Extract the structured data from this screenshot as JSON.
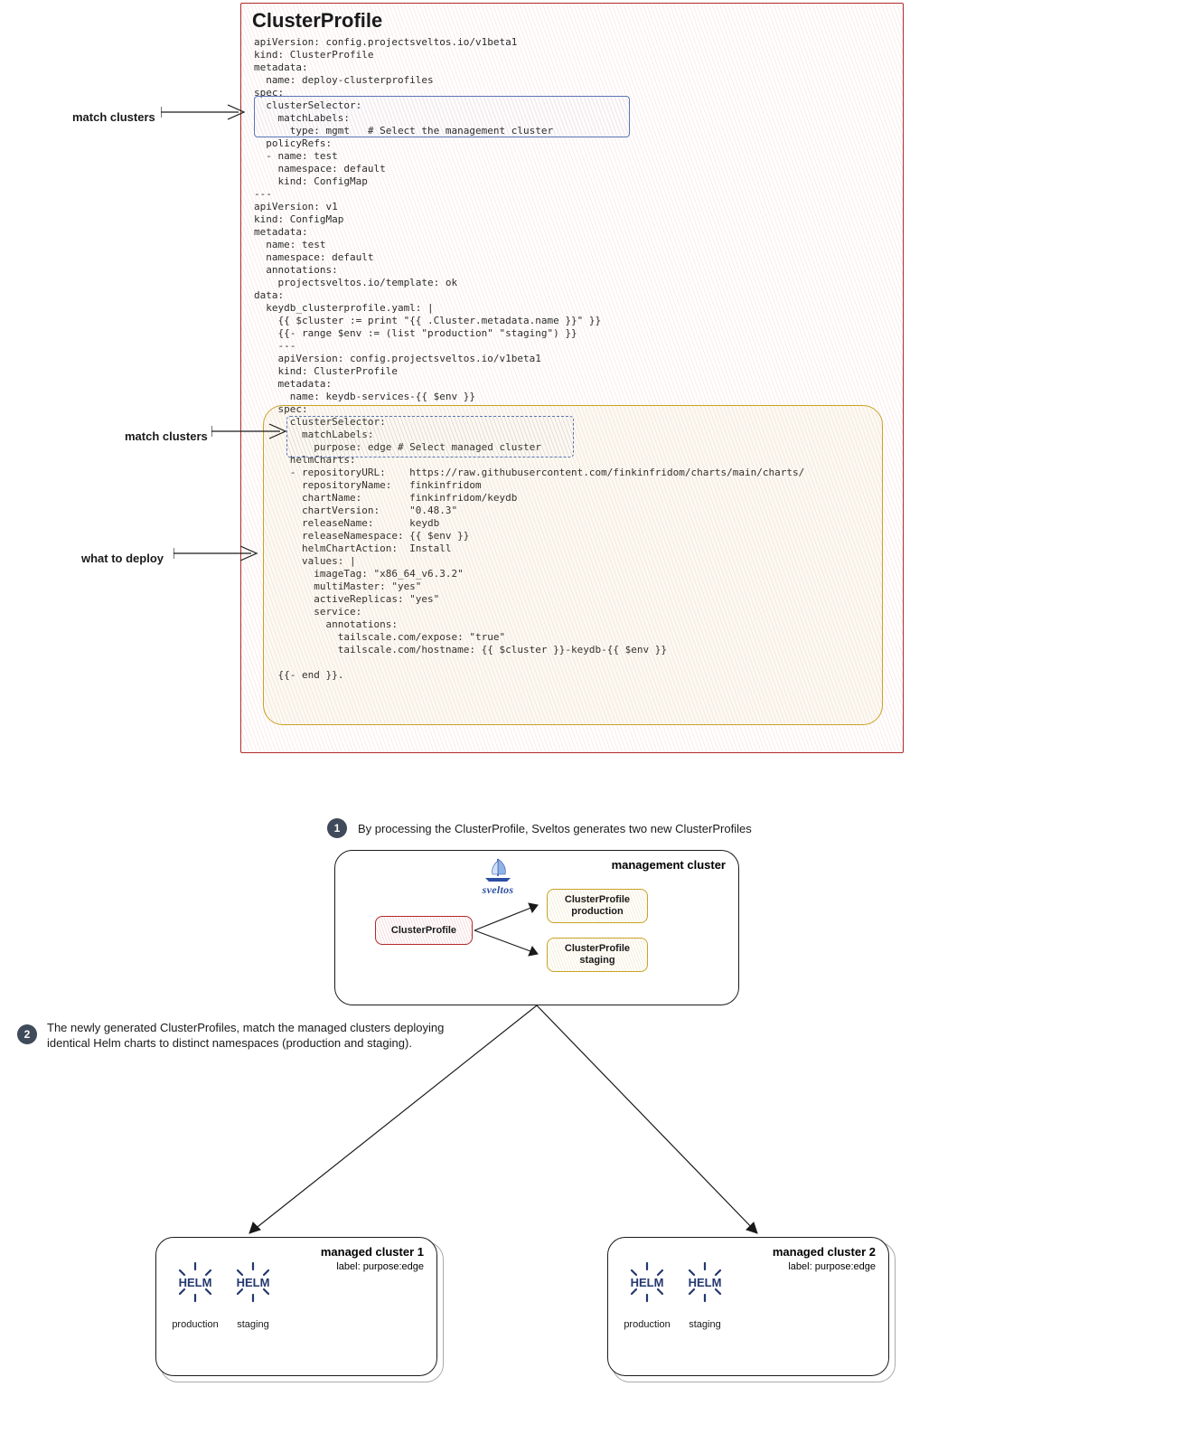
{
  "top": {
    "title": "ClusterProfile",
    "code": "apiVersion: config.projectsveltos.io/v1beta1\nkind: ClusterProfile\nmetadata:\n  name: deploy-clusterprofiles\nspec:\n  clusterSelector:\n    matchLabels:\n      type: mgmt   # Select the management cluster\n  policyRefs:\n  - name: test\n    namespace: default\n    kind: ConfigMap\n---\napiVersion: v1\nkind: ConfigMap\nmetadata:\n  name: test\n  namespace: default\n  annotations:\n    projectsveltos.io/template: ok\ndata:\n  keydb_clusterprofile.yaml: |\n    {{ $cluster := print \"{{ .Cluster.metadata.name }}\" }}\n    {{- range $env := (list \"production\" \"staging\") }}\n    ---\n    apiVersion: config.projectsveltos.io/v1beta1\n    kind: ClusterProfile\n    metadata:\n      name: keydb-services-{{ $env }}\n    spec:\n      clusterSelector:\n        matchLabels:\n          purpose: edge # Select managed cluster\n      helmCharts:\n      - repositoryURL:    https://raw.githubusercontent.com/finkinfridom/charts/main/charts/\n        repositoryName:   finkinfridom\n        chartName:        finkinfridom/keydb\n        chartVersion:     \"0.48.3\"\n        releaseName:      keydb\n        releaseNamespace: {{ $env }}\n        helmChartAction:  Install\n        values: |\n          imageTag: \"x86_64_v6.3.2\"\n          multiMaster: \"yes\"\n          activeReplicas: \"yes\"\n          service:\n            annotations:\n              tailscale.com/expose: \"true\"\n              tailscale.com/hostname: {{ $cluster }}-keydb-{{ $env }}\n\n    {{- end }}."
  },
  "annotations": {
    "match1": "match clusters",
    "match2": "match clusters",
    "deploy": "what to deploy"
  },
  "steps": {
    "s1_num": "1",
    "s1_text": "By processing the ClusterProfile, Sveltos generates two new ClusterProfiles",
    "s2_num": "2",
    "s2_text": "The newly generated ClusterProfiles, match the managed clusters deploying\nidentical Helm charts to distinct namespaces (production and staging)."
  },
  "mgmt": {
    "title": "management cluster",
    "logo": "sveltos",
    "source": "ClusterProfile",
    "prod": "ClusterProfile\nproduction",
    "staging": "ClusterProfile\nstaging"
  },
  "managed1": {
    "title": "managed cluster 1",
    "sublabel": "label: purpose:edge",
    "h1": "production",
    "h2": "staging"
  },
  "managed2": {
    "title": "managed cluster 2",
    "sublabel": "label: purpose:edge",
    "h1": "production",
    "h2": "staging"
  },
  "helm_word": "HELM"
}
